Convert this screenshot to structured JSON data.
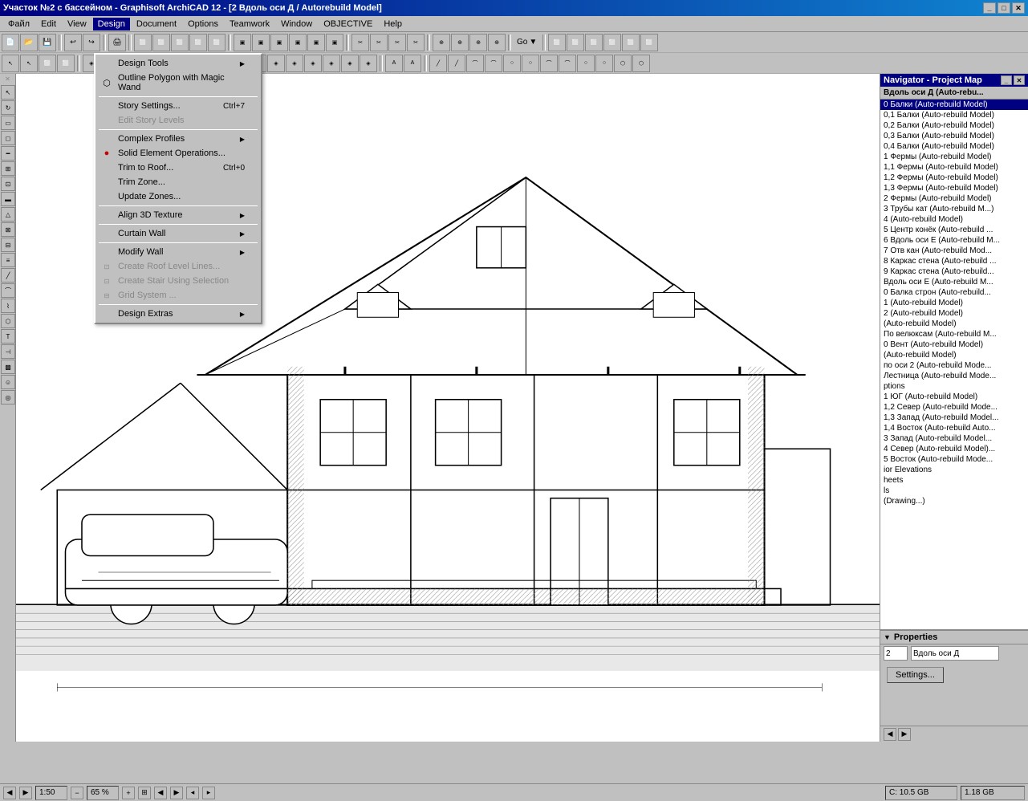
{
  "window": {
    "title": "Участок №2 с бассейном - Graphisoft ArchiCAD 12 - [2 Вдоль оси Д / Autorebuild Model]",
    "title_btn_minimize": "_",
    "title_btn_restore": "□",
    "title_btn_close": "✕"
  },
  "menubar": {
    "items": [
      {
        "label": "Файл",
        "id": "file"
      },
      {
        "label": "Edit",
        "id": "edit"
      },
      {
        "label": "View",
        "id": "view"
      },
      {
        "label": "Design",
        "id": "design",
        "active": true
      },
      {
        "label": "Document",
        "id": "document"
      },
      {
        "label": "Options",
        "id": "options"
      },
      {
        "label": "Teamwork",
        "id": "teamwork"
      },
      {
        "label": "Window",
        "id": "window"
      },
      {
        "label": "OBJECTIVE",
        "id": "objective"
      },
      {
        "label": "Help",
        "id": "help"
      }
    ]
  },
  "design_menu": {
    "items": [
      {
        "label": "Design Tools",
        "id": "design-tools",
        "has_sub": true,
        "disabled": false
      },
      {
        "label": "Outline Polygon with Magic Wand",
        "id": "outline-polygon",
        "disabled": false
      },
      {
        "separator": true
      },
      {
        "label": "Story Settings...",
        "id": "story-settings",
        "shortcut": "Ctrl+7",
        "disabled": false
      },
      {
        "label": "Edit Story Levels",
        "id": "edit-story",
        "disabled": true
      },
      {
        "separator": true
      },
      {
        "label": "Complex Profiles",
        "id": "complex-profiles",
        "has_sub": true,
        "disabled": false
      },
      {
        "label": "Solid Element Operations...",
        "id": "solid-element",
        "has_icon": true,
        "disabled": false
      },
      {
        "label": "Trim to Roof...",
        "id": "trim-roof",
        "shortcut": "Ctrl+0",
        "disabled": false
      },
      {
        "label": "Trim Zone...",
        "id": "trim-zone",
        "disabled": false
      },
      {
        "label": "Update Zones...",
        "id": "update-zones",
        "disabled": false
      },
      {
        "separator": true
      },
      {
        "label": "Align 3D Texture",
        "id": "align-3d",
        "has_sub": true,
        "disabled": false
      },
      {
        "separator": true
      },
      {
        "label": "Curtain Wall",
        "id": "curtain-wall",
        "has_sub": true,
        "disabled": false
      },
      {
        "separator": true
      },
      {
        "label": "Modify Wall",
        "id": "modify-wall",
        "has_sub": true,
        "disabled": false
      },
      {
        "label": "Create Roof Level Lines...",
        "id": "create-roof-lines",
        "disabled": true
      },
      {
        "label": "Create Stair Using Selection",
        "id": "create-stair",
        "disabled": true
      },
      {
        "label": "Grid System ...",
        "id": "grid-system",
        "disabled": true
      },
      {
        "separator": true
      },
      {
        "label": "Design Extras",
        "id": "design-extras",
        "has_sub": true,
        "disabled": false
      }
    ]
  },
  "navigator": {
    "title": "Navigator - Project Map",
    "header_text": "Вдоль оси Д (Auto-rebu...",
    "items": [
      "0 Балки (Auto-rebuild Model)",
      "0,1 Балки (Auto-rebuild Model)",
      "0,2 Балки (Auto-rebuild Model)",
      "0,3 Балки (Auto-rebuild Model)",
      "0,4 Балки (Auto-rebuild Model)",
      "1 Фермы (Auto-rebuild Model)",
      "1,1 Фермы (Auto-rebuild Model)",
      "1,2 Фермы (Auto-rebuild Model)",
      "1,3 Фермы (Auto-rebuild Model)",
      "2 Фермы (Auto-rebuild Model)",
      "3 Трубы кат (Auto-rebuild M...)",
      "4 (Auto-rebuild Model)",
      "5 Центр конёк (Auto-rebuild ...",
      "6 Вдоль оси Е (Auto-rebuild M...",
      "7 Отв кан (Auto-rebuild Mod...",
      "8 Каркас стена (Auto-rebuild ...",
      "9 Каркас стена (Auto-rebuild...",
      "Вдоль оси Е (Auto-rebuild M...",
      "0 Балка строн (Auto-rebuild...",
      "1 (Auto-rebuild Model)",
      "2 (Auto-rebuild Model)",
      "(Auto-rebuild Model)",
      "По велюксам (Auto-rebuild M...",
      "0 Вент (Auto-rebuild Model)",
      "(Auto-rebuild Model)",
      "по оси 2 (Auto-rebuild Mode...",
      "Лестница (Auto-rebuild Mode...",
      "ptions",
      "1 ЮГ (Auto-rebuild Model)",
      "1,2 Север (Auto-rebuild Mode...",
      "1,3 Запад (Auto-rebuild Model...",
      "1,4 Восток (Auto-rebuild Auto...",
      "3 Запад (Auto-rebuild Model...",
      "4 Север (Auto-rebuild Model)...",
      "5 Восток (Auto-rebuild Mode...",
      "ior Elevations",
      "heets",
      "ls",
      "(Drawing...)"
    ]
  },
  "properties": {
    "title": "Properties",
    "field1_value": "2",
    "field2_value": "Вдоль оси Д",
    "settings_label": "Settings..."
  },
  "statusbar": {
    "story": "1:50",
    "zoom": "65 %",
    "disk": "C: 10.5 GB",
    "ram": "1.18 GB"
  }
}
